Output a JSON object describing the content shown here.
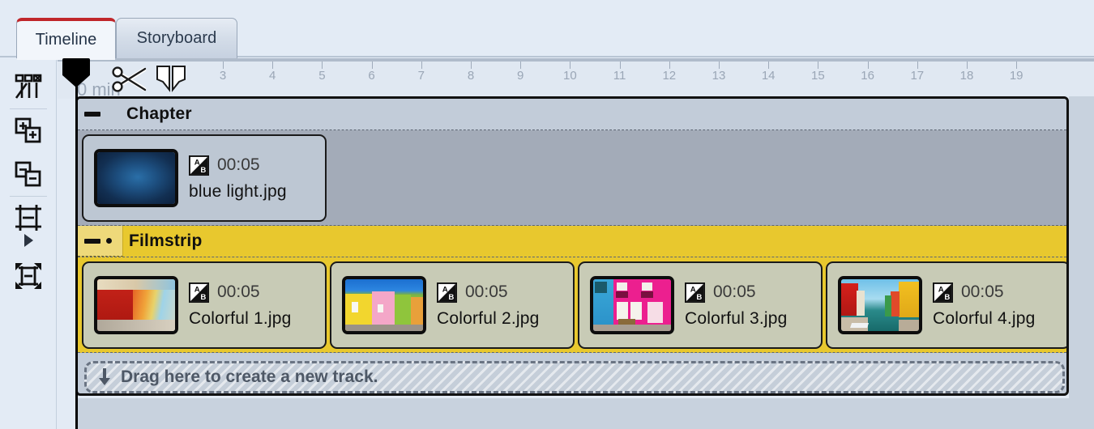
{
  "tabs": [
    {
      "label": "Timeline",
      "active": true
    },
    {
      "label": "Storyboard",
      "active": false
    }
  ],
  "toolbar": {
    "items": [
      {
        "name": "timeline-view-icon",
        "label": "Timeline view"
      },
      {
        "name": "zoom-in-icon",
        "label": "Zoom in"
      },
      {
        "name": "zoom-out-icon",
        "label": "Zoom out"
      },
      {
        "name": "fit-width-icon",
        "label": "Fit to width"
      },
      {
        "name": "expand-arrow-icon",
        "label": "Expand"
      },
      {
        "name": "fit-all-icon",
        "label": "Fit all"
      }
    ]
  },
  "ruler": {
    "zero_label": "0 min",
    "ticks": [
      3,
      4,
      5,
      6,
      7,
      8,
      9,
      10,
      11,
      12,
      13,
      14,
      15,
      16,
      17,
      18,
      19
    ],
    "overlay_icons": [
      {
        "name": "scissors-icon",
        "label": "Split clip"
      },
      {
        "name": "split-marker-icon",
        "label": "Split marker"
      }
    ]
  },
  "playhead": {
    "position_label": "0 min"
  },
  "tracks": [
    {
      "name": "chapter",
      "title": "Chapter",
      "header_color": "#c2ccd9",
      "body_color": "#a3abb8",
      "has_dot": false,
      "clips": [
        {
          "duration": "00:05",
          "filename": "blue light.jpg",
          "transition_icon": "ab-transition-icon",
          "thumb": "blue-light-thumb"
        }
      ]
    },
    {
      "name": "filmstrip",
      "title": "Filmstrip",
      "header_color": "#e8c82e",
      "body_color": "#e8c82e",
      "has_dot": true,
      "clips": [
        {
          "duration": "00:05",
          "filename": "Colorful 1.jpg",
          "transition_icon": "ab-transition-icon",
          "thumb": "colorful-1-thumb"
        },
        {
          "duration": "00:05",
          "filename": "Colorful 2.jpg",
          "transition_icon": "ab-transition-icon",
          "thumb": "colorful-2-thumb"
        },
        {
          "duration": "00:05",
          "filename": "Colorful 3.jpg",
          "transition_icon": "ab-transition-icon",
          "thumb": "colorful-3-thumb"
        },
        {
          "duration": "00:05",
          "filename": "Colorful 4.jpg",
          "transition_icon": "ab-transition-icon",
          "thumb": "colorful-4-thumb"
        }
      ]
    }
  ],
  "dropzone": {
    "label": "Drag here to create a new track.",
    "icon": "arrow-down-icon"
  },
  "colors": {
    "accent_tab": "#c0262a",
    "filmstrip": "#e8c82e",
    "chapter_body": "#a3abb8",
    "panel_bg": "#e3ebf5"
  }
}
